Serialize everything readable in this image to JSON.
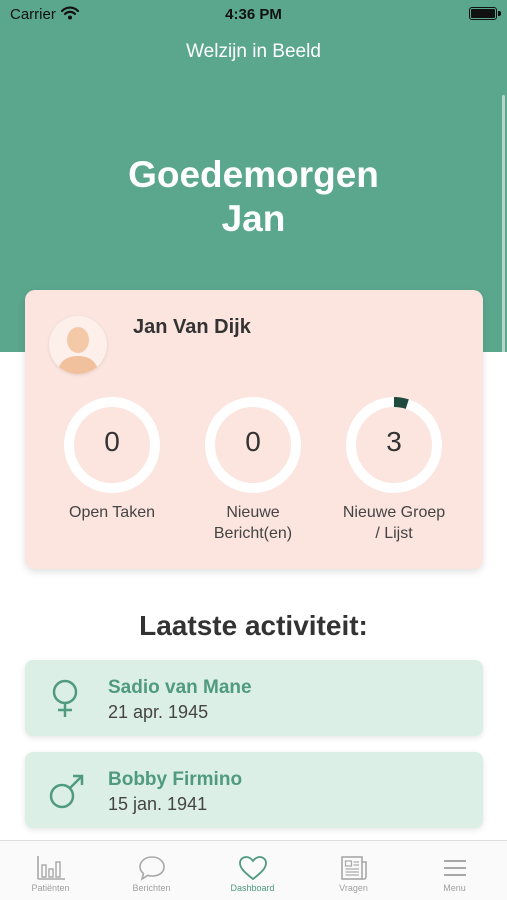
{
  "status_bar": {
    "carrier": "Carrier",
    "time": "4:36 PM"
  },
  "header": {
    "title": "Welzijn in Beeld",
    "greeting_line1": "Goedemorgen",
    "greeting_line2": "Jan"
  },
  "profile": {
    "name": "Jan Van Dijk",
    "stats": [
      {
        "value": "0",
        "label": "Open Taken",
        "progress": 0
      },
      {
        "value": "0",
        "label": "Nieuwe Bericht(en)",
        "progress": 0
      },
      {
        "value": "3",
        "label": "Nieuwe Groep / Lijst",
        "progress": 0.05
      }
    ]
  },
  "activity": {
    "title": "Laatste activiteit:",
    "items": [
      {
        "name": "Sadio van Mane",
        "date": "21 apr. 1945",
        "icon": "female-icon"
      },
      {
        "name": "Bobby Firmino",
        "date": "15 jan. 1941",
        "icon": "male-icon"
      }
    ]
  },
  "tabs": [
    {
      "label": "Patiënten",
      "icon": "bar-chart-icon"
    },
    {
      "label": "Berichten",
      "icon": "chat-icon"
    },
    {
      "label": "Dashboard",
      "icon": "heart-icon",
      "active": true
    },
    {
      "label": "Vragen",
      "icon": "newspaper-icon"
    },
    {
      "label": "Menu",
      "icon": "menu-icon"
    }
  ],
  "colors": {
    "primary": "#5ba78e",
    "card": "#fbe5de",
    "activity_card": "#dcefe6",
    "progress": "#1f4a3d"
  }
}
